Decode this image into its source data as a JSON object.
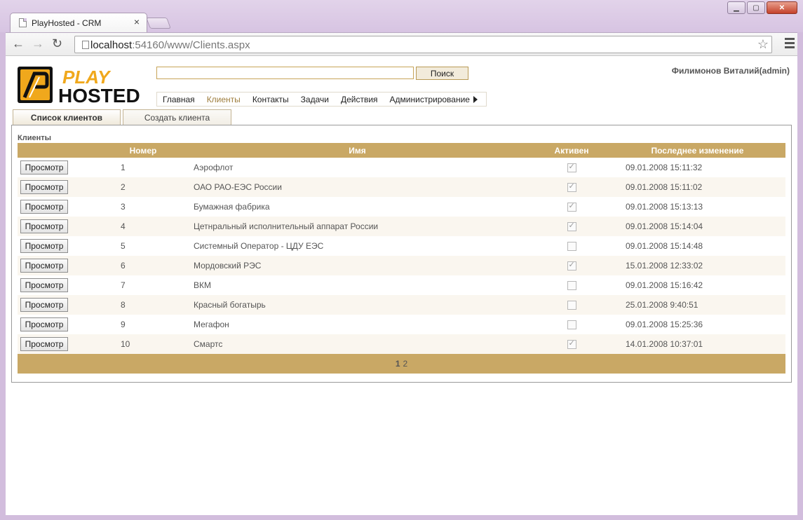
{
  "browser": {
    "tab_title": "PlayHosted - CRM",
    "url_host": "localhost",
    "url_rest": ":54160/www/Clients.aspx"
  },
  "header": {
    "logo_top": "PLAY",
    "logo_bottom": "HOSTED",
    "search_button": "Поиск",
    "search_value": "",
    "user": "Филимонов Виталий(admin)"
  },
  "menu": {
    "items": [
      "Главная",
      "Клиенты",
      "Контакты",
      "Задачи",
      "Действия",
      "Администрирование"
    ],
    "active": "Клиенты"
  },
  "tabs": {
    "list": "Список клиентов",
    "create": "Создать клиента"
  },
  "grid": {
    "caption": "Клиенты",
    "columns": [
      "",
      "Номер",
      "Имя",
      "Активен",
      "Последнее изменение"
    ],
    "view_label": "Просмотр",
    "rows": [
      {
        "num": "1",
        "name": "Аэрофлот",
        "active": true,
        "modified": "09.01.2008 15:11:32"
      },
      {
        "num": "2",
        "name": "ОАО РАО-ЕЭС России",
        "active": true,
        "modified": "09.01.2008 15:11:02"
      },
      {
        "num": "3",
        "name": "Бумажная фабрика",
        "active": true,
        "modified": "09.01.2008 15:13:13"
      },
      {
        "num": "4",
        "name": "Цетнральный исполнительный аппарат России",
        "active": true,
        "modified": "09.01.2008 15:14:04"
      },
      {
        "num": "5",
        "name": "Системный Оператор - ЦДУ ЕЭС",
        "active": false,
        "modified": "09.01.2008 15:14:48"
      },
      {
        "num": "6",
        "name": "Мордовский РЭС",
        "active": true,
        "modified": "15.01.2008 12:33:02"
      },
      {
        "num": "7",
        "name": "ВКМ",
        "active": false,
        "modified": "09.01.2008 15:16:42"
      },
      {
        "num": "8",
        "name": "Красный богатырь",
        "active": false,
        "modified": "25.01.2008 9:40:51"
      },
      {
        "num": "9",
        "name": "Мегафон",
        "active": false,
        "modified": "09.01.2008 15:25:36"
      },
      {
        "num": "10",
        "name": "Смартс",
        "active": true,
        "modified": "14.01.2008 10:37:01"
      }
    ],
    "pager": {
      "current": "1",
      "other": "2"
    }
  },
  "colors": {
    "accent": "#c9a865",
    "logo_orange": "#f0a81c",
    "logo_dark": "#111111"
  }
}
